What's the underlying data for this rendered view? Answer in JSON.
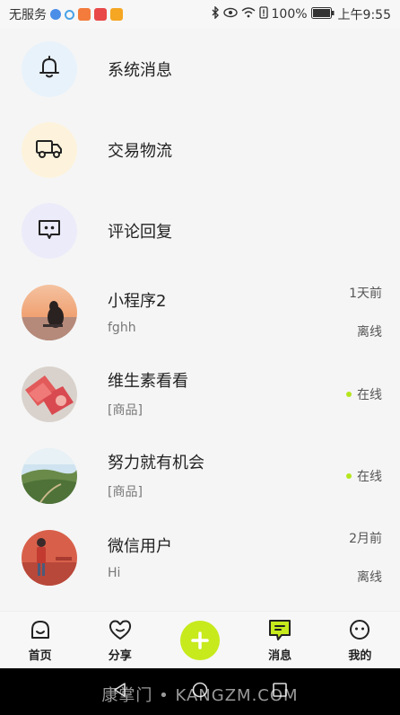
{
  "status_bar": {
    "carrier": "无服务",
    "battery": "100%",
    "time": "上午9:55"
  },
  "system_items": [
    {
      "label": "系统消息",
      "icon": "bell-icon",
      "bg": "#e8f2fb"
    },
    {
      "label": "交易物流",
      "icon": "truck-icon",
      "bg": "#fdf3dc"
    },
    {
      "label": "评论回复",
      "icon": "comment-icon",
      "bg": "#ecebfa"
    }
  ],
  "chats": [
    {
      "name": "小程序2",
      "message": "fghh",
      "time": "1天前",
      "status": "离线",
      "online": false
    },
    {
      "name": "维生素看看",
      "message": "[商品]",
      "time": "",
      "status": "在线",
      "online": true
    },
    {
      "name": "努力就有机会",
      "message": "[商品]",
      "time": "",
      "status": "在线",
      "online": true
    },
    {
      "name": "微信用户",
      "message": "Hi",
      "time": "2月前",
      "status": "离线",
      "online": false
    }
  ],
  "tabbar": {
    "tabs": [
      {
        "label": "首页",
        "icon": "home-face-icon"
      },
      {
        "label": "分享",
        "icon": "heart-icon"
      },
      {
        "label": "",
        "icon": "plus-icon"
      },
      {
        "label": "消息",
        "icon": "message-icon"
      },
      {
        "label": "我的",
        "icon": "profile-face-icon"
      }
    ]
  },
  "watermark": "康掌门 • KANGZM.COM",
  "colors": {
    "accent": "#c6ea1c",
    "online": "#b5e61d"
  }
}
